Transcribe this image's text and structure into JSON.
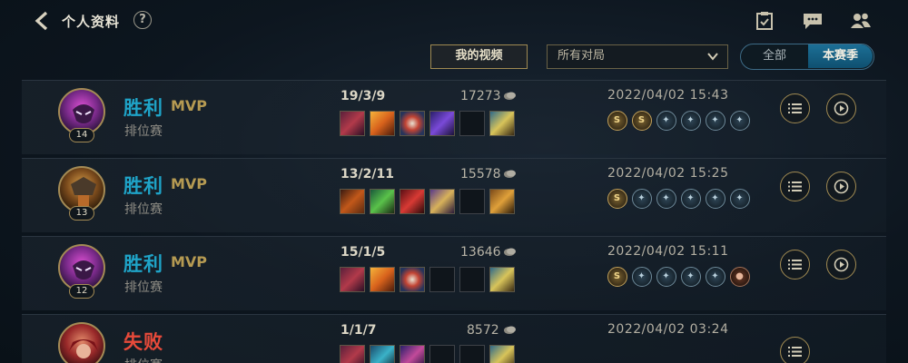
{
  "header": {
    "title": "个人资料",
    "help_glyph": "?"
  },
  "filters": {
    "videos_button": "我的视频",
    "match_filter": "所有对局",
    "segment_all": "全部",
    "segment_season": "本赛季"
  },
  "colors": {
    "win": "#1fa4c8",
    "loss": "#e84a3a",
    "gold_accent": "#a08a52",
    "mvp": "#b59a52"
  },
  "matches": [
    {
      "champion_icon": "purple-masked-champion-icon",
      "level": "14",
      "result": "胜利",
      "mvp": "MVP",
      "queue": "排位赛",
      "kda": "19/3/9",
      "gold": "17273",
      "items": [
        "item-red-blade",
        "item-flame-sword",
        "item-crest-shield",
        "item-purple-staff",
        "empty",
        "item-trinket-totem"
      ],
      "date": "2022/04/02 15:43",
      "badges": [
        "gold-s",
        "gold-s",
        "blue",
        "blue",
        "blue",
        "blue"
      ]
    },
    {
      "champion_icon": "armored-warrior-champion-icon",
      "level": "13",
      "result": "胜利",
      "mvp": "MVP",
      "queue": "排位赛",
      "kda": "13/2/11",
      "gold": "15578",
      "items": [
        "item-fire-axe",
        "item-green-bow",
        "item-red-hammer",
        "item-gold-shield",
        "empty",
        "item-trinket-lens"
      ],
      "date": "2022/04/02 15:25",
      "badges": [
        "gold-s",
        "blue",
        "blue",
        "blue",
        "blue",
        "blue"
      ]
    },
    {
      "champion_icon": "purple-masked-champion-icon",
      "level": "12",
      "result": "胜利",
      "mvp": "MVP",
      "queue": "排位赛",
      "kda": "15/1/5",
      "gold": "13646",
      "items": [
        "item-red-blade",
        "item-flame-sword",
        "item-crest-shield",
        "empty",
        "empty",
        "item-trinket-totem"
      ],
      "date": "2022/04/02 15:11",
      "badges": [
        "gold-s",
        "blue",
        "blue",
        "blue",
        "blue",
        "bronze"
      ]
    },
    {
      "champion_icon": "red-haired-champion-icon",
      "level": "",
      "result": "失败",
      "mvp": "",
      "queue": "排位赛",
      "kda": "1/1/7",
      "gold": "8572",
      "items": [
        "item-red-blade",
        "item-blue-orb",
        "item-purple-staff",
        "empty",
        "empty",
        "item-trinket-totem"
      ],
      "date": "2022/04/02 03:24",
      "badges": []
    }
  ]
}
